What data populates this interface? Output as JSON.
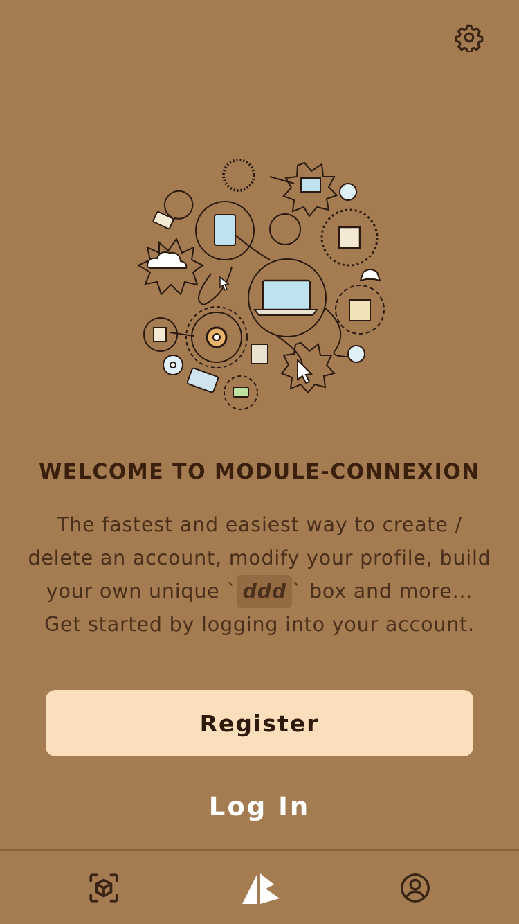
{
  "header": {
    "settings_icon": "gear-icon"
  },
  "welcome": {
    "title": "WELCOME TO MODULE-CONNEXION",
    "line1": "The fastest and easiest way to create /",
    "line2": "delete an account, modify your profile, build",
    "line3_before": "your own unique `",
    "line3_code": "ddd",
    "line3_after": "` box and more...",
    "line4": "Get started by logging into your account."
  },
  "actions": {
    "register_label": "Register",
    "login_label": "Log In"
  },
  "bottom_nav": {
    "items": [
      {
        "icon": "ar-cube-scan-icon"
      },
      {
        "icon": "app-logo-icon"
      },
      {
        "icon": "account-circle-icon"
      }
    ]
  },
  "colors": {
    "background": "#a57b52",
    "register_button": "#fbdfbd",
    "title_text": "#3a1f0d",
    "body_text": "#4a2f1a"
  }
}
